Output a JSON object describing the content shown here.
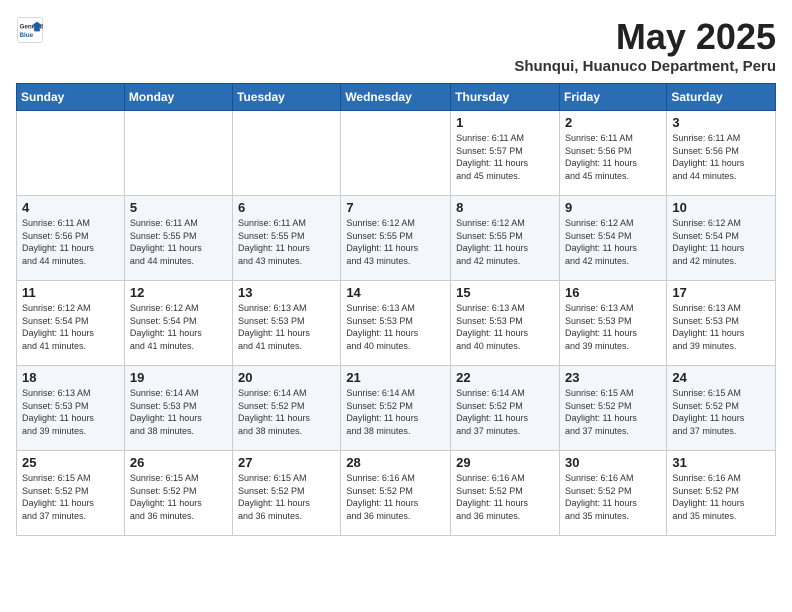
{
  "logo": {
    "general": "General",
    "blue": "Blue"
  },
  "header": {
    "title": "May 2025",
    "subtitle": "Shunqui, Huanuco Department, Peru"
  },
  "days_of_week": [
    "Sunday",
    "Monday",
    "Tuesday",
    "Wednesday",
    "Thursday",
    "Friday",
    "Saturday"
  ],
  "weeks": [
    [
      {
        "day": "",
        "text": ""
      },
      {
        "day": "",
        "text": ""
      },
      {
        "day": "",
        "text": ""
      },
      {
        "day": "",
        "text": ""
      },
      {
        "day": "1",
        "text": "Sunrise: 6:11 AM\nSunset: 5:57 PM\nDaylight: 11 hours\nand 45 minutes."
      },
      {
        "day": "2",
        "text": "Sunrise: 6:11 AM\nSunset: 5:56 PM\nDaylight: 11 hours\nand 45 minutes."
      },
      {
        "day": "3",
        "text": "Sunrise: 6:11 AM\nSunset: 5:56 PM\nDaylight: 11 hours\nand 44 minutes."
      }
    ],
    [
      {
        "day": "4",
        "text": "Sunrise: 6:11 AM\nSunset: 5:56 PM\nDaylight: 11 hours\nand 44 minutes."
      },
      {
        "day": "5",
        "text": "Sunrise: 6:11 AM\nSunset: 5:55 PM\nDaylight: 11 hours\nand 44 minutes."
      },
      {
        "day": "6",
        "text": "Sunrise: 6:11 AM\nSunset: 5:55 PM\nDaylight: 11 hours\nand 43 minutes."
      },
      {
        "day": "7",
        "text": "Sunrise: 6:12 AM\nSunset: 5:55 PM\nDaylight: 11 hours\nand 43 minutes."
      },
      {
        "day": "8",
        "text": "Sunrise: 6:12 AM\nSunset: 5:55 PM\nDaylight: 11 hours\nand 42 minutes."
      },
      {
        "day": "9",
        "text": "Sunrise: 6:12 AM\nSunset: 5:54 PM\nDaylight: 11 hours\nand 42 minutes."
      },
      {
        "day": "10",
        "text": "Sunrise: 6:12 AM\nSunset: 5:54 PM\nDaylight: 11 hours\nand 42 minutes."
      }
    ],
    [
      {
        "day": "11",
        "text": "Sunrise: 6:12 AM\nSunset: 5:54 PM\nDaylight: 11 hours\nand 41 minutes."
      },
      {
        "day": "12",
        "text": "Sunrise: 6:12 AM\nSunset: 5:54 PM\nDaylight: 11 hours\nand 41 minutes."
      },
      {
        "day": "13",
        "text": "Sunrise: 6:13 AM\nSunset: 5:53 PM\nDaylight: 11 hours\nand 41 minutes."
      },
      {
        "day": "14",
        "text": "Sunrise: 6:13 AM\nSunset: 5:53 PM\nDaylight: 11 hours\nand 40 minutes."
      },
      {
        "day": "15",
        "text": "Sunrise: 6:13 AM\nSunset: 5:53 PM\nDaylight: 11 hours\nand 40 minutes."
      },
      {
        "day": "16",
        "text": "Sunrise: 6:13 AM\nSunset: 5:53 PM\nDaylight: 11 hours\nand 39 minutes."
      },
      {
        "day": "17",
        "text": "Sunrise: 6:13 AM\nSunset: 5:53 PM\nDaylight: 11 hours\nand 39 minutes."
      }
    ],
    [
      {
        "day": "18",
        "text": "Sunrise: 6:13 AM\nSunset: 5:53 PM\nDaylight: 11 hours\nand 39 minutes."
      },
      {
        "day": "19",
        "text": "Sunrise: 6:14 AM\nSunset: 5:53 PM\nDaylight: 11 hours\nand 38 minutes."
      },
      {
        "day": "20",
        "text": "Sunrise: 6:14 AM\nSunset: 5:52 PM\nDaylight: 11 hours\nand 38 minutes."
      },
      {
        "day": "21",
        "text": "Sunrise: 6:14 AM\nSunset: 5:52 PM\nDaylight: 11 hours\nand 38 minutes."
      },
      {
        "day": "22",
        "text": "Sunrise: 6:14 AM\nSunset: 5:52 PM\nDaylight: 11 hours\nand 37 minutes."
      },
      {
        "day": "23",
        "text": "Sunrise: 6:15 AM\nSunset: 5:52 PM\nDaylight: 11 hours\nand 37 minutes."
      },
      {
        "day": "24",
        "text": "Sunrise: 6:15 AM\nSunset: 5:52 PM\nDaylight: 11 hours\nand 37 minutes."
      }
    ],
    [
      {
        "day": "25",
        "text": "Sunrise: 6:15 AM\nSunset: 5:52 PM\nDaylight: 11 hours\nand 37 minutes."
      },
      {
        "day": "26",
        "text": "Sunrise: 6:15 AM\nSunset: 5:52 PM\nDaylight: 11 hours\nand 36 minutes."
      },
      {
        "day": "27",
        "text": "Sunrise: 6:15 AM\nSunset: 5:52 PM\nDaylight: 11 hours\nand 36 minutes."
      },
      {
        "day": "28",
        "text": "Sunrise: 6:16 AM\nSunset: 5:52 PM\nDaylight: 11 hours\nand 36 minutes."
      },
      {
        "day": "29",
        "text": "Sunrise: 6:16 AM\nSunset: 5:52 PM\nDaylight: 11 hours\nand 36 minutes."
      },
      {
        "day": "30",
        "text": "Sunrise: 6:16 AM\nSunset: 5:52 PM\nDaylight: 11 hours\nand 35 minutes."
      },
      {
        "day": "31",
        "text": "Sunrise: 6:16 AM\nSunset: 5:52 PM\nDaylight: 11 hours\nand 35 minutes."
      }
    ]
  ]
}
